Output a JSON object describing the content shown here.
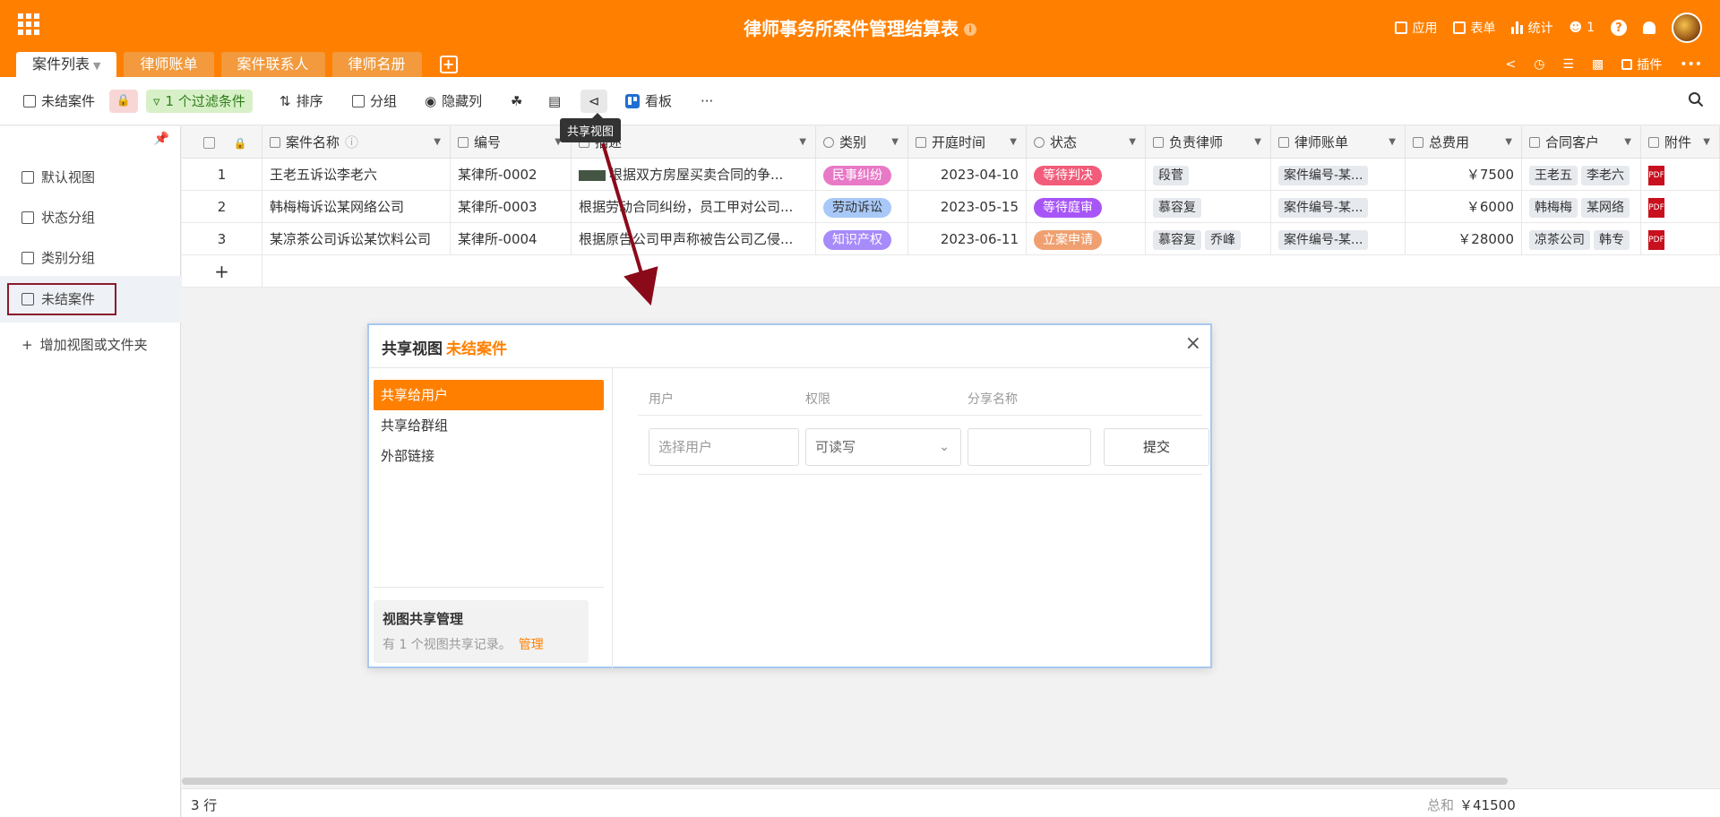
{
  "header": {
    "title": "律师事务所案件管理结算表",
    "right": {
      "apps": "应用",
      "forms": "表单",
      "stats": "统计",
      "collaborators": "1"
    }
  },
  "tabs": [
    "案件列表",
    "律师账单",
    "案件联系人",
    "律师名册"
  ],
  "tab_right": {
    "plugins": "插件"
  },
  "toolbar": {
    "view_name": "未结案件",
    "filter": "1 个过滤条件",
    "sort": "排序",
    "group": "分组",
    "hide": "隐藏列",
    "kanban": "看板",
    "more": "···",
    "tooltip": "共享视图"
  },
  "sidebar": {
    "items": [
      "默认视图",
      "状态分组",
      "类别分组",
      "未结案件"
    ],
    "add": "增加视图或文件夹"
  },
  "table": {
    "columns": [
      "案件名称",
      "编号",
      "描述",
      "类别",
      "开庭时间",
      "状态",
      "负责律师",
      "律师账单",
      "总费用",
      "合同客户",
      "附件"
    ],
    "rows": [
      {
        "n": "1",
        "name": "王老五诉讼李老六",
        "code": "某律所-0002",
        "desc": "根据双方房屋买卖合同的争...",
        "cat": "民事纠纷",
        "cat_color": "#e879c7",
        "date": "2023-04-10",
        "status": "等待判决",
        "status_color": "#f25c7a",
        "lawyers": [
          "段菅"
        ],
        "bill": "案件编号-某...",
        "fee": "￥7500",
        "clients": [
          "王老五",
          "李老六"
        ]
      },
      {
        "n": "2",
        "name": "韩梅梅诉讼某网络公司",
        "code": "某律所-0003",
        "desc": "根据劳动合同纠纷，员工甲对公司...",
        "cat": "劳动诉讼",
        "cat_color": "#a8c8f8",
        "date": "2023-05-15",
        "status": "等待庭审",
        "status_color": "#a855f7",
        "lawyers": [
          "慕容复"
        ],
        "bill": "案件编号-某...",
        "fee": "￥6000",
        "clients": [
          "韩梅梅",
          "某网络"
        ]
      },
      {
        "n": "3",
        "name": "某凉茶公司诉讼某饮料公司",
        "code": "某律所-0004",
        "desc": "根据原告公司甲声称被告公司乙侵...",
        "cat": "知识产权",
        "cat_color": "#a78bfa",
        "date": "2023-06-11",
        "status": "立案申请",
        "status_color": "#f0a070",
        "lawyers": [
          "慕容复",
          "乔峰"
        ],
        "bill": "案件编号-某...",
        "fee": "￥28000",
        "clients": [
          "凉茶公司",
          "韩专"
        ]
      }
    ],
    "add": "+"
  },
  "dialog": {
    "title": "共享视图",
    "view": "未结案件",
    "nav": [
      "共享给用户",
      "共享给群组",
      "外部链接"
    ],
    "cols": {
      "user": "用户",
      "perm": "权限",
      "share_name": "分享名称"
    },
    "user_placeholder": "选择用户",
    "perm_value": "可读写",
    "submit": "提交",
    "mgmt_title": "视图共享管理",
    "mgmt_text": "有 1 个视图共享记录。",
    "mgmt_link": "管理"
  },
  "footer": {
    "rows": "3 行",
    "sum_label": "总和",
    "sum_value": "￥41500"
  },
  "colors": {
    "brand": "#ff8000",
    "selected_border": "#8a1a2a",
    "arrow": "#8b0a1a"
  }
}
